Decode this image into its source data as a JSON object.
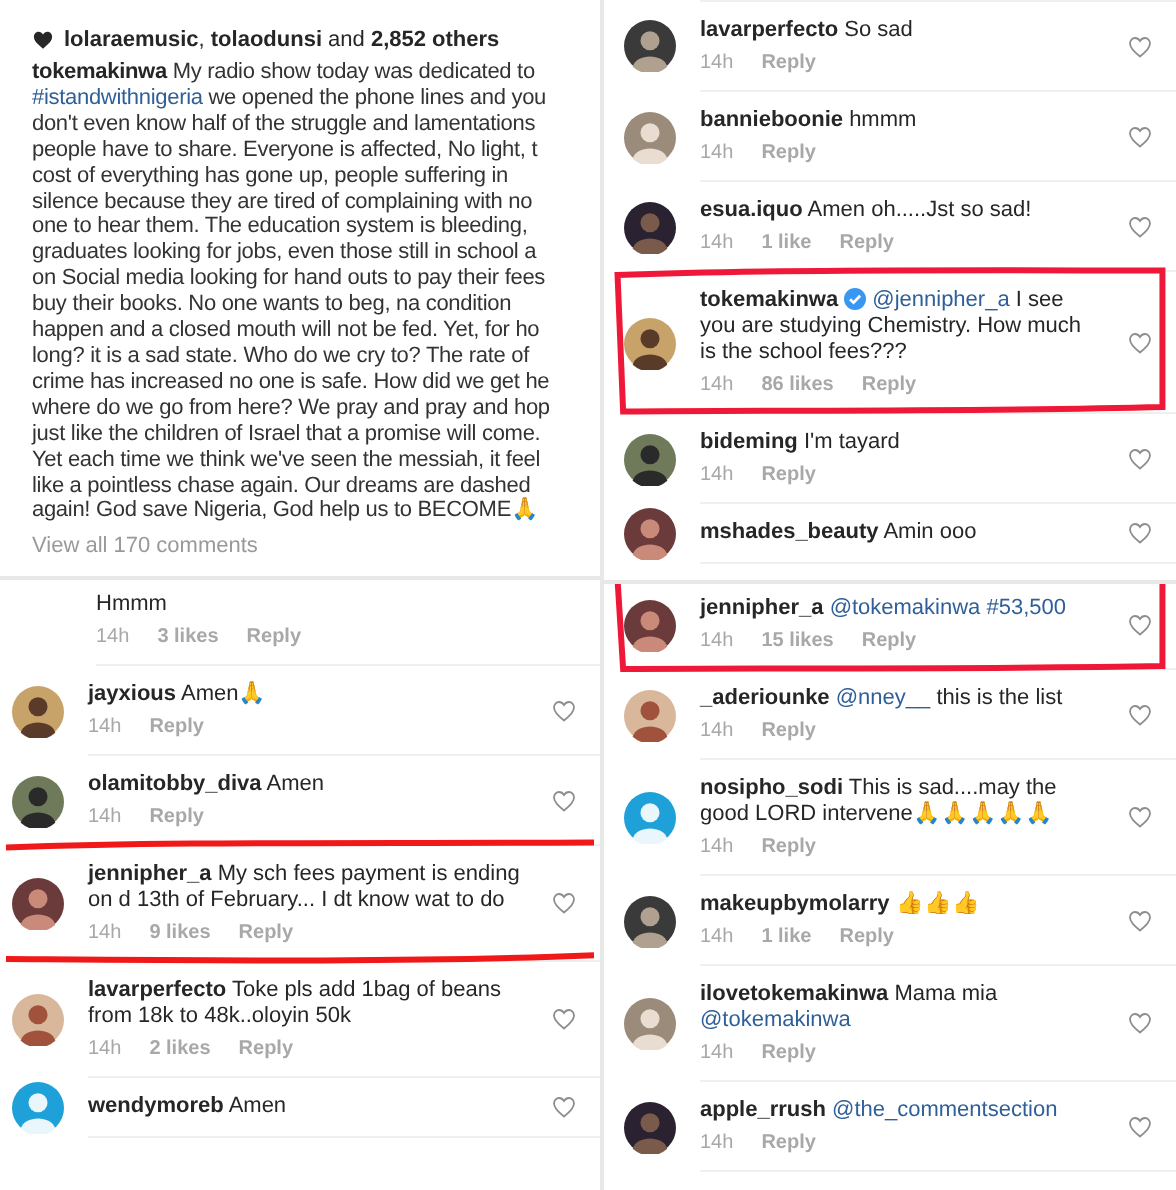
{
  "left_column": [
    {
      "kind": "caption",
      "likes": [
        {
          "kind": "bold",
          "text": "lolaraemusic"
        },
        {
          "kind": "text",
          "text": ", "
        },
        {
          "kind": "bold",
          "text": "tolaodunsi"
        },
        {
          "kind": "text",
          "text": " and "
        },
        {
          "kind": "bold",
          "text": "2,852 others"
        }
      ],
      "lines": [
        [
          {
            "kind": "user",
            "text": "tokemakinwa"
          },
          {
            "kind": "text",
            "text": " My radio show today was dedicated to"
          }
        ],
        [
          {
            "kind": "link",
            "text": "#istandwithnigeria"
          },
          {
            "kind": "text",
            "text": " we opened the phone lines and you"
          }
        ],
        [
          {
            "kind": "text",
            "text": "don't even know half of the struggle and lamentations"
          }
        ],
        [
          {
            "kind": "text",
            "text": "people have to share. Everyone is affected, No light, t"
          }
        ],
        [
          {
            "kind": "text",
            "text": "cost of everything has gone up, people suffering in"
          }
        ],
        [
          {
            "kind": "text",
            "text": "silence because they are tired of complaining with no"
          }
        ],
        [
          {
            "kind": "text",
            "text": "one to hear them. The education system is bleeding,"
          }
        ],
        [
          {
            "kind": "text",
            "text": "graduates looking for jobs, even those still in school a"
          }
        ],
        [
          {
            "kind": "text",
            "text": "on Social media looking for hand outs to pay their fees"
          }
        ],
        [
          {
            "kind": "text",
            "text": "buy their books. No one wants to beg, na condition"
          }
        ],
        [
          {
            "kind": "text",
            "text": "happen and a closed mouth will not be fed. Yet, for ho"
          }
        ],
        [
          {
            "kind": "text",
            "text": "long? it is a sad state. Who do we cry to? The rate of"
          }
        ],
        [
          {
            "kind": "text",
            "text": "crime has increased no one is safe. How did we get he"
          }
        ],
        [
          {
            "kind": "text",
            "text": "where do we go from here? We pray and pray and hop"
          }
        ],
        [
          {
            "kind": "text",
            "text": "just like the children of Israel that a promise will come."
          }
        ],
        [
          {
            "kind": "text",
            "text": "Yet each time we think we've seen the messiah, it feel"
          }
        ],
        [
          {
            "kind": "text",
            "text": "like a pointless chase again. Our dreams are dashed"
          }
        ],
        [
          {
            "kind": "text",
            "text": "again! God save Nigeria, God help us to BECOME🙏"
          }
        ]
      ],
      "view_all": "View all 170 comments"
    },
    {
      "kind": "comments",
      "comments": [
        {
          "text": [
            {
              "kind": "text",
              "text": "Hmmm"
            }
          ],
          "time": "14h",
          "likes": "3 likes",
          "reply": "Reply",
          "underlined": false,
          "boxed": false
        },
        {
          "user": "jayxious",
          "text": [
            {
              "kind": "text",
              "text": "Amen🙏"
            }
          ],
          "time": "14h",
          "reply": "Reply",
          "underlined": false,
          "boxed": false
        },
        {
          "user": "olamitobby_diva",
          "text": [
            {
              "kind": "text",
              "text": "Amen"
            }
          ],
          "time": "14h",
          "reply": "Reply",
          "underlined": false,
          "boxed": false
        },
        {
          "user": "jennipher_a",
          "text": [
            {
              "kind": "text",
              "text": "My sch fees payment is ending on d 13th of February... I dt know wat to do"
            }
          ],
          "time": "14h",
          "likes": "9 likes",
          "reply": "Reply",
          "underlined": true,
          "boxed": false
        },
        {
          "user": "lavarperfecto",
          "text": [
            {
              "kind": "text",
              "text": "Toke pls add 1bag of beans from 18k to 48k..oloyin 50k"
            }
          ],
          "time": "14h",
          "likes": "2 likes",
          "reply": "Reply",
          "underlined": false,
          "boxed": false
        },
        {
          "user": "wendymoreb",
          "text": [
            {
              "kind": "text",
              "text": "Amen"
            }
          ],
          "underlined": false,
          "boxed": false
        }
      ]
    }
  ],
  "right_column": [
    {
      "kind": "comments",
      "comments": [
        {
          "user": "lavarperfecto",
          "text": [
            {
              "kind": "text",
              "text": "So sad"
            }
          ],
          "time": "14h",
          "reply": "Reply",
          "underlined": false,
          "boxed": false
        },
        {
          "user": "bannieboonie",
          "text": [
            {
              "kind": "text",
              "text": "hmmm"
            }
          ],
          "time": "14h",
          "reply": "Reply",
          "underlined": false,
          "boxed": false
        },
        {
          "user": "esua.iquo",
          "text": [
            {
              "kind": "text",
              "text": "Amen oh.....Jst so sad!"
            }
          ],
          "time": "14h",
          "likes": "1 like",
          "reply": "Reply",
          "underlined": false,
          "boxed": false
        },
        {
          "user": "tokemakinwa",
          "verified": true,
          "text": [
            {
              "kind": "link",
              "text": "@jennipher_a"
            },
            {
              "kind": "text",
              "text": " I see you are studying Chemistry. How much is the school fees???"
            }
          ],
          "time": "14h",
          "likes": "86 likes",
          "reply": "Reply",
          "underlined": false,
          "boxed": true
        },
        {
          "user": "bideming",
          "text": [
            {
              "kind": "text",
              "text": "I'm tayard"
            }
          ],
          "time": "14h",
          "reply": "Reply",
          "underlined": false,
          "boxed": false
        },
        {
          "user": "mshades_beauty",
          "text": [
            {
              "kind": "text",
              "text": "Amin ooo"
            }
          ],
          "underlined": false,
          "boxed": false
        }
      ]
    },
    {
      "kind": "comments",
      "comments": [
        {
          "user": "jennipher_a",
          "text": [
            {
              "kind": "link",
              "text": "@tokemakinwa #53,500"
            }
          ],
          "time": "14h",
          "likes": "15 likes",
          "reply": "Reply",
          "underlined": false,
          "boxed": true
        },
        {
          "user": "_aderiounke",
          "text": [
            {
              "kind": "link",
              "text": "@nney__"
            },
            {
              "kind": "text",
              "text": " this is the list"
            }
          ],
          "time": "14h",
          "reply": "Reply",
          "underlined": false,
          "boxed": false
        },
        {
          "user": "nosipho_sodi",
          "text": [
            {
              "kind": "text",
              "text": "This is sad....may the good LORD intervene🙏🙏🙏🙏🙏"
            }
          ],
          "time": "14h",
          "reply": "Reply",
          "underlined": false,
          "boxed": false
        },
        {
          "user": "makeupbymolarry",
          "text": [
            {
              "kind": "text",
              "text": "👍👍👍"
            }
          ],
          "time": "14h",
          "likes": "1 like",
          "reply": "Reply",
          "underlined": false,
          "boxed": false
        },
        {
          "user": "ilovetokemakinwa",
          "text": [
            {
              "kind": "text",
              "text": "Mama mia "
            },
            {
              "kind": "link",
              "text": "@tokemakinwa"
            }
          ],
          "time": "14h",
          "reply": "Reply",
          "underlined": false,
          "boxed": false
        },
        {
          "user": "apple_rrush",
          "text": [
            {
              "kind": "link",
              "text": "@the_commentsection"
            }
          ],
          "time": "14h",
          "reply": "Reply",
          "underlined": false,
          "boxed": false
        }
      ]
    }
  ]
}
